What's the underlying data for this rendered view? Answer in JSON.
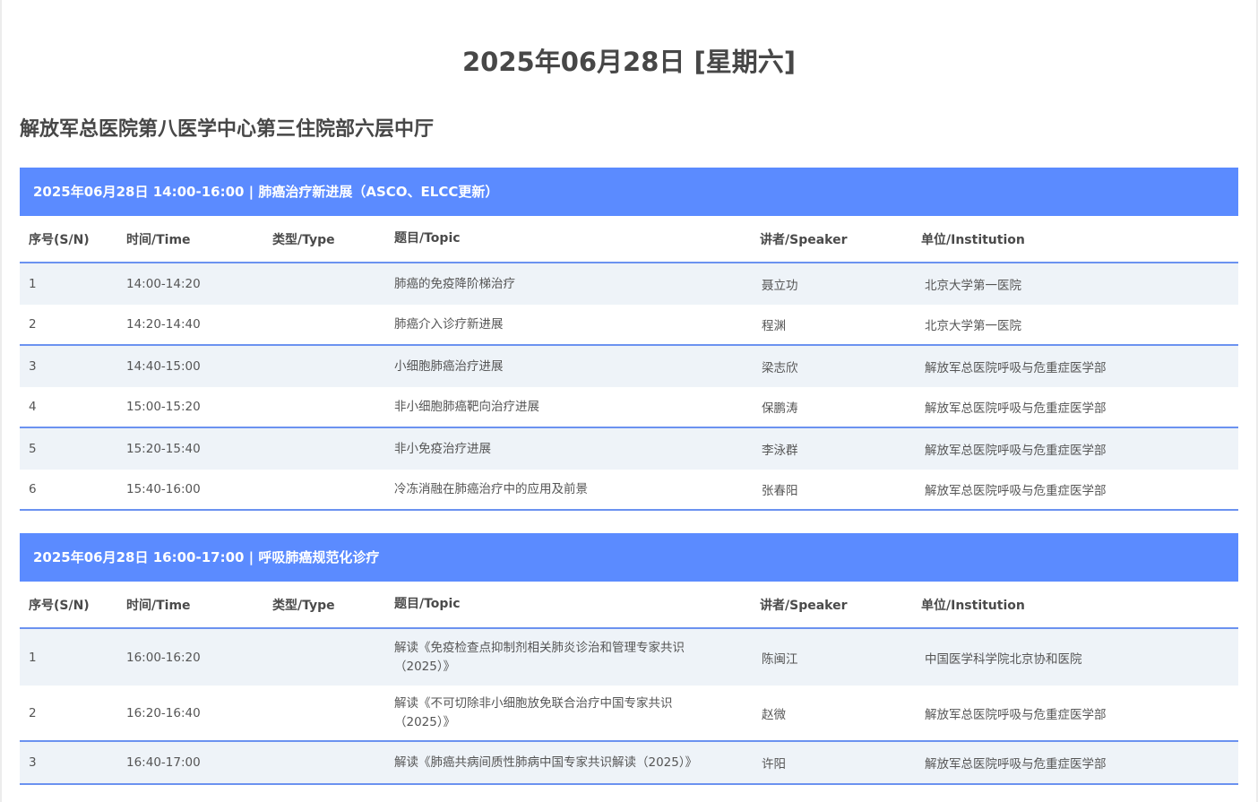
{
  "page": {
    "date_title": "2025年06月28日 [星期六]",
    "venue": "解放军总医院第八医学中心第三住院部六层中厅"
  },
  "columns": {
    "sn": "序号(S/N)",
    "time": "时间/Time",
    "type": "类型/Type",
    "topic": "题目/Topic",
    "speaker": "讲者/Speaker",
    "institution": "单位/Institution"
  },
  "sessions": [
    {
      "header": "2025年06月28日 14:00-16:00 | 肺癌治疗新进展（ASCO、ELCC更新）",
      "rows": [
        {
          "sn": "1",
          "time": "14:00-14:20",
          "type": "",
          "topic": "肺癌的免疫降阶梯治疗",
          "speaker": "聂立功",
          "institution": "北京大学第一医院"
        },
        {
          "sn": "2",
          "time": "14:20-14:40",
          "type": "",
          "topic": "肺癌介入诊疗新进展",
          "speaker": "程渊",
          "institution": "北京大学第一医院"
        },
        {
          "sn": "3",
          "time": "14:40-15:00",
          "type": "",
          "topic": "小细胞肺癌治疗进展",
          "speaker": "梁志欣",
          "institution": "解放军总医院呼吸与危重症医学部"
        },
        {
          "sn": "4",
          "time": "15:00-15:20",
          "type": "",
          "topic": "非小细胞肺癌靶向治疗进展",
          "speaker": "保鹏涛",
          "institution": "解放军总医院呼吸与危重症医学部"
        },
        {
          "sn": "5",
          "time": "15:20-15:40",
          "type": "",
          "topic": "非小免疫治疗进展",
          "speaker": "李泳群",
          "institution": "解放军总医院呼吸与危重症医学部"
        },
        {
          "sn": "6",
          "time": "15:40-16:00",
          "type": "",
          "topic": "冷冻消融在肺癌治疗中的应用及前景",
          "speaker": "张春阳",
          "institution": "解放军总医院呼吸与危重症医学部"
        }
      ]
    },
    {
      "header": "2025年06月28日 16:00-17:00 | 呼吸肺癌规范化诊疗",
      "rows": [
        {
          "sn": "1",
          "time": "16:00-16:20",
          "type": "",
          "topic": "解读《免疫检查点抑制剂相关肺炎诊治和管理专家共识（2025）》",
          "speaker": "陈闽江",
          "institution": "中国医学科学院北京协和医院"
        },
        {
          "sn": "2",
          "time": "16:20-16:40",
          "type": "",
          "topic": "解读《不可切除非小细胞放免联合治疗中国专家共识（2025）》",
          "speaker": "赵微",
          "institution": "解放军总医院呼吸与危重症医学部"
        },
        {
          "sn": "3",
          "time": "16:40-17:00",
          "type": "",
          "topic": "解读《肺癌共病间质性肺病中国专家共识解读（2025）》",
          "speaker": "许阳",
          "institution": "解放军总医院呼吸与危重症医学部"
        }
      ]
    }
  ]
}
